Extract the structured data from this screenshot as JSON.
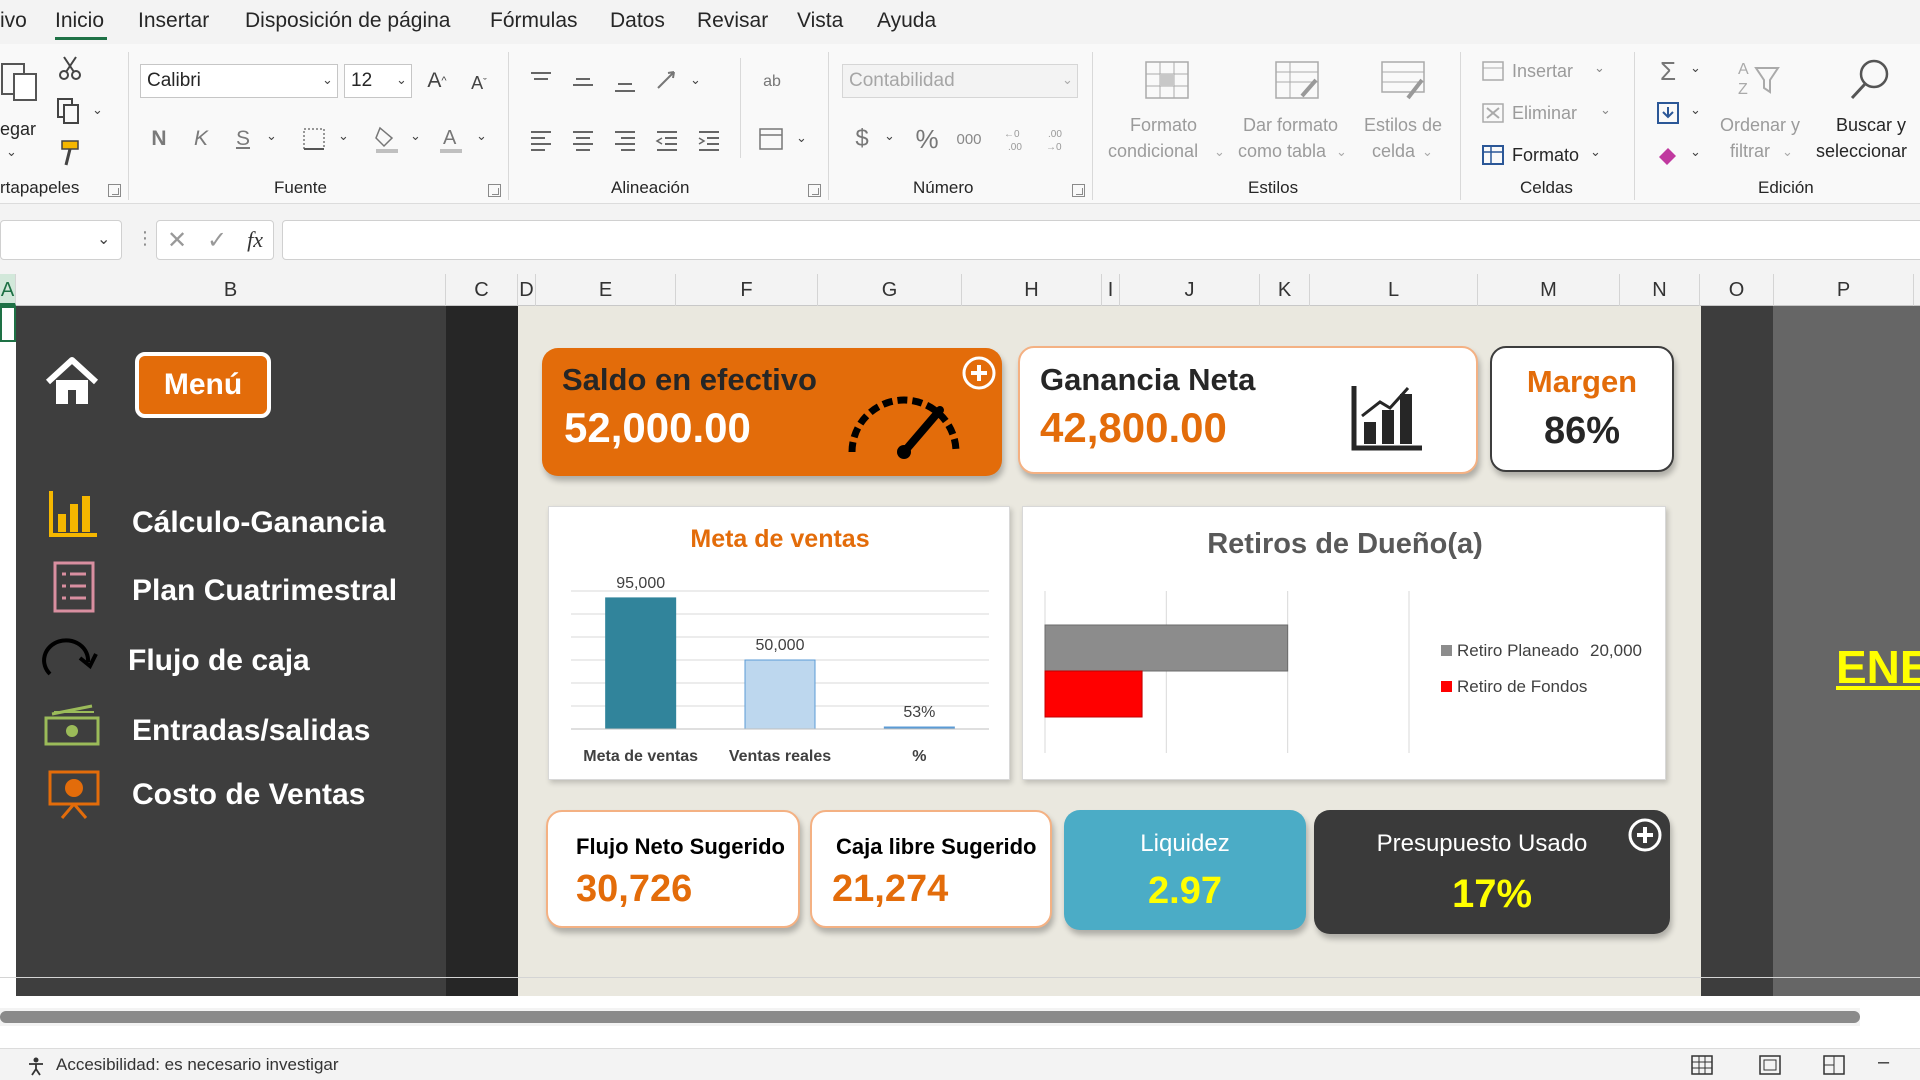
{
  "menu": {
    "tabs": [
      "ivo",
      "Inicio",
      "Insertar",
      "Disposición de página",
      "Fórmulas",
      "Datos",
      "Revisar",
      "Vista",
      "Ayuda"
    ],
    "active": "Inicio"
  },
  "ribbon": {
    "clipboard": {
      "paste_label": "egar",
      "group": "rtapapeles"
    },
    "font": {
      "name": "Calibri",
      "size": "12",
      "group": "Fuente",
      "bold": "N",
      "italic": "K",
      "underline": "S"
    },
    "alignment": {
      "group": "Alineación"
    },
    "number": {
      "format": "Contabilidad",
      "group": "Número",
      "currency": "$",
      "percent": "%",
      "thousands": "000"
    },
    "styles": {
      "group": "Estilos",
      "conditional": [
        "Formato",
        "condicional"
      ],
      "as_table": [
        "Dar formato",
        "como tabla"
      ],
      "cell_styles": [
        "Estilos de",
        "celda"
      ]
    },
    "cells": {
      "group": "Celdas",
      "insert": "Insertar",
      "delete": "Eliminar",
      "format": "Formato"
    },
    "editing": {
      "group": "Edición",
      "sort": [
        "Ordenar y",
        "filtrar"
      ],
      "find": [
        "Buscar y",
        "seleccionar"
      ]
    }
  },
  "formula_bar": {
    "name_box": "",
    "fx": "fx",
    "content": ""
  },
  "columns": [
    "A",
    "B",
    "C",
    "D",
    "E",
    "F",
    "G",
    "H",
    "I",
    "J",
    "K",
    "L",
    "M",
    "N",
    "O",
    "P"
  ],
  "sidebar": {
    "menu_button": "Menú",
    "items": [
      {
        "label": "Cálculo-Ganancia",
        "icon": "bar-chart-icon"
      },
      {
        "label": "Plan Cuatrimestral",
        "icon": "checklist-icon"
      },
      {
        "label": "Flujo de caja",
        "icon": "refresh-arrow-icon"
      },
      {
        "label": "Entradas/salidas",
        "icon": "cash-icon"
      },
      {
        "label": "Costo de Ventas",
        "icon": "presentation-icon"
      }
    ]
  },
  "kpis": {
    "saldo": {
      "title": "Saldo en efectivo",
      "value": "52,000.00"
    },
    "ganancia": {
      "title": "Ganancia Neta",
      "value": "42,800.00"
    },
    "margen": {
      "title": "Margen",
      "value": "86%"
    },
    "flujo": {
      "title": "Flujo Neto Sugerido",
      "value": "30,726"
    },
    "caja": {
      "title": "Caja libre Sugerido",
      "value": "21,274"
    },
    "liquidez": {
      "title": "Liquidez",
      "value": "2.97"
    },
    "presupuesto": {
      "title": "Presupuesto Usado",
      "value": "17%"
    }
  },
  "right_panel_text": "ENE",
  "colors": {
    "orange": "#e36c0a",
    "teal_bar": "#31849b",
    "light_blue_bar": "#bdd7ee",
    "liquidez": "#4bacc6",
    "dark_card": "#3a3a3a",
    "yellow": "#ffff00"
  },
  "chart_data": [
    {
      "type": "bar",
      "title": "Meta de ventas",
      "categories": [
        "Meta de ventas",
        "Ventas reales",
        "%"
      ],
      "values": [
        95000,
        50000,
        0.53
      ],
      "data_labels": [
        "95,000",
        "50,000",
        "53%"
      ],
      "ylim": [
        0,
        100000
      ],
      "grid": true,
      "legend": "none"
    },
    {
      "type": "bar",
      "orientation": "horizontal",
      "title": "Retiros de Dueño(a)",
      "series": [
        {
          "name": "Retiro Planeado",
          "values": [
            20000
          ],
          "color": "#8c8c8c"
        },
        {
          "name": "Retiro de Fondos",
          "values": [
            8000
          ],
          "color": "#ff0000"
        }
      ],
      "legend_value": "20,000",
      "xlim": [
        0,
        30000
      ],
      "grid": true,
      "legend": "right"
    }
  ],
  "status": {
    "accessibility": "Accesibilidad: es necesario investigar"
  }
}
